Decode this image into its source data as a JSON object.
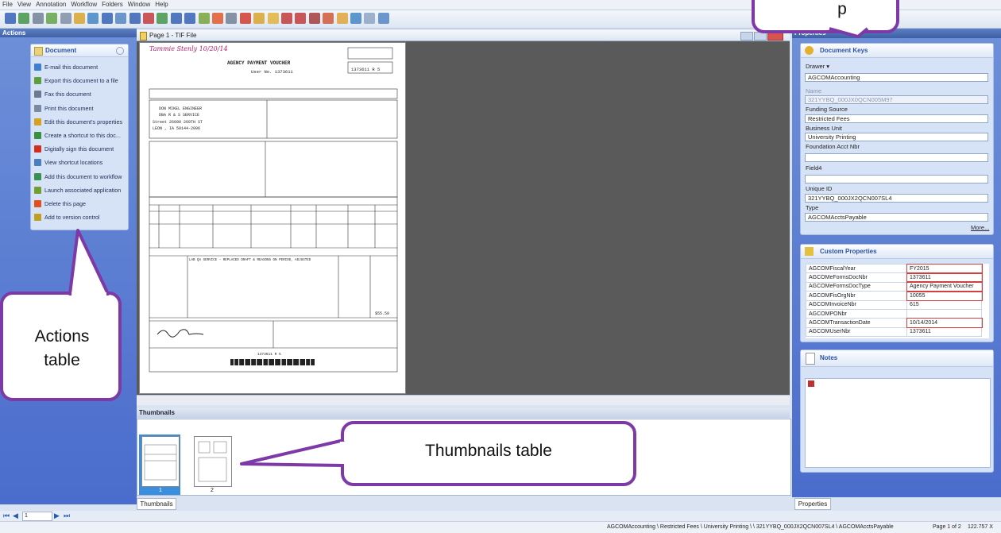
{
  "menu": [
    "File",
    "View",
    "Annotation",
    "Workflow",
    "Folders",
    "Window",
    "Help"
  ],
  "actions_pane": {
    "title": "Actions",
    "box_title": "Document",
    "items": [
      {
        "label": "E-mail this document",
        "icon": "email-icon",
        "color": "#3f7fd0"
      },
      {
        "label": "Export this document to a file",
        "icon": "export-icon",
        "color": "#5aa040"
      },
      {
        "label": "Fax this document",
        "icon": "fax-icon",
        "color": "#6a7a90"
      },
      {
        "label": "Print this document",
        "icon": "printer-icon",
        "color": "#7a8aa0"
      },
      {
        "label": "Edit this document's properties",
        "icon": "key-icon",
        "color": "#d8a020"
      },
      {
        "label": "Create a shortcut to this doc...",
        "icon": "shortcut-icon",
        "color": "#3a9040"
      },
      {
        "label": "Digitally sign this document",
        "icon": "ribbon-icon",
        "color": "#d03020"
      },
      {
        "label": "View shortcut locations",
        "icon": "locations-icon",
        "color": "#4a80c0"
      },
      {
        "label": "Add this document to workflow",
        "icon": "workflow-icon",
        "color": "#3a9050"
      },
      {
        "label": "Launch associated application",
        "icon": "launch-icon",
        "color": "#70a030"
      },
      {
        "label": "Delete this page",
        "icon": "delete-icon",
        "color": "#e05020"
      },
      {
        "label": "Add to version control",
        "icon": "version-icon",
        "color": "#c0a020"
      }
    ]
  },
  "callouts": {
    "actions": "Actions table",
    "thumbnails": "Thumbnails table",
    "top": "p"
  },
  "viewer": {
    "title": "Page 1 - TIF File"
  },
  "document": {
    "signature": "Tammie Stenly 10/20/14",
    "title": "AGENCY PAYMENT VOUCHER",
    "user_no": "User No. 1373611",
    "voucher_no": "1373611 R 5",
    "body_line": "LAB QA SERVICE - REPLACED DRAFT & REASONS ON PERIOD, ADJUSTED",
    "vendor": "DON MIKEL ENGINEER",
    "vendor2": "DBA R & S SERVICE",
    "street": "Street 26090 260TH ST",
    "city": "LEON , IA 50144-2096",
    "total": "$55.50",
    "barcode_no": "1373611 R 5"
  },
  "thumbnails": {
    "title": "Thumbnails",
    "pages": [
      "1",
      "2"
    ],
    "tab": "Thumbnails"
  },
  "properties": {
    "title": "Properties",
    "doc_keys_title": "Document Keys",
    "drawer_label": "Drawer",
    "drawer_value": "AGCOMAccounting",
    "name_label": "Name",
    "name_value": "321YYBQ_000JX0QCN005M97",
    "funding_label": "Funding Source",
    "funding_value": "Restricted Fees",
    "business_label": "Business Unit",
    "business_value": "University Printing",
    "foundation_label": "Foundation Acct Nbr",
    "foundation_value": "",
    "field4_label": "Field4",
    "field4_value": "",
    "unique_label": "Unique ID",
    "unique_value": "321YYBQ_000JX2QCN007SL4",
    "type_label": "Type",
    "type_value": "AGCOMAcctsPayable",
    "more_label": "More...",
    "custom_title": "Custom Properties",
    "custom_rows": [
      {
        "key": "AGCOMFiscalYear",
        "value": "FY2015",
        "hl": true
      },
      {
        "key": "AGCOMeFormsDocNbr",
        "value": "1373611",
        "hl": true
      },
      {
        "key": "AGCOMeFormsDocType",
        "value": "Agency Payment Voucher",
        "hl": true
      },
      {
        "key": "AGCOMFisOrgNbr",
        "value": "10055",
        "hl": true
      },
      {
        "key": "AGCOMInvoiceNbr",
        "value": "615",
        "hl": false
      },
      {
        "key": "AGCOMPONbr",
        "value": "",
        "hl": false
      },
      {
        "key": "AGCOMTransactionDate",
        "value": "10/14/2014",
        "hl": true
      },
      {
        "key": "AGCOMUserNbr",
        "value": "1373611",
        "hl": false
      }
    ],
    "notes_title": "Notes",
    "tab": "Properties"
  },
  "status": {
    "path": "AGCOMAccounting \\ Restricted Fees \\ University Printing \\ \\ 321YYBQ_000JX2QCN007SL4 \\ AGCOMAcctsPayable",
    "page": "Page 1 of 2",
    "zoom": "122.757 X"
  },
  "nav": {
    "page_value": "1"
  }
}
